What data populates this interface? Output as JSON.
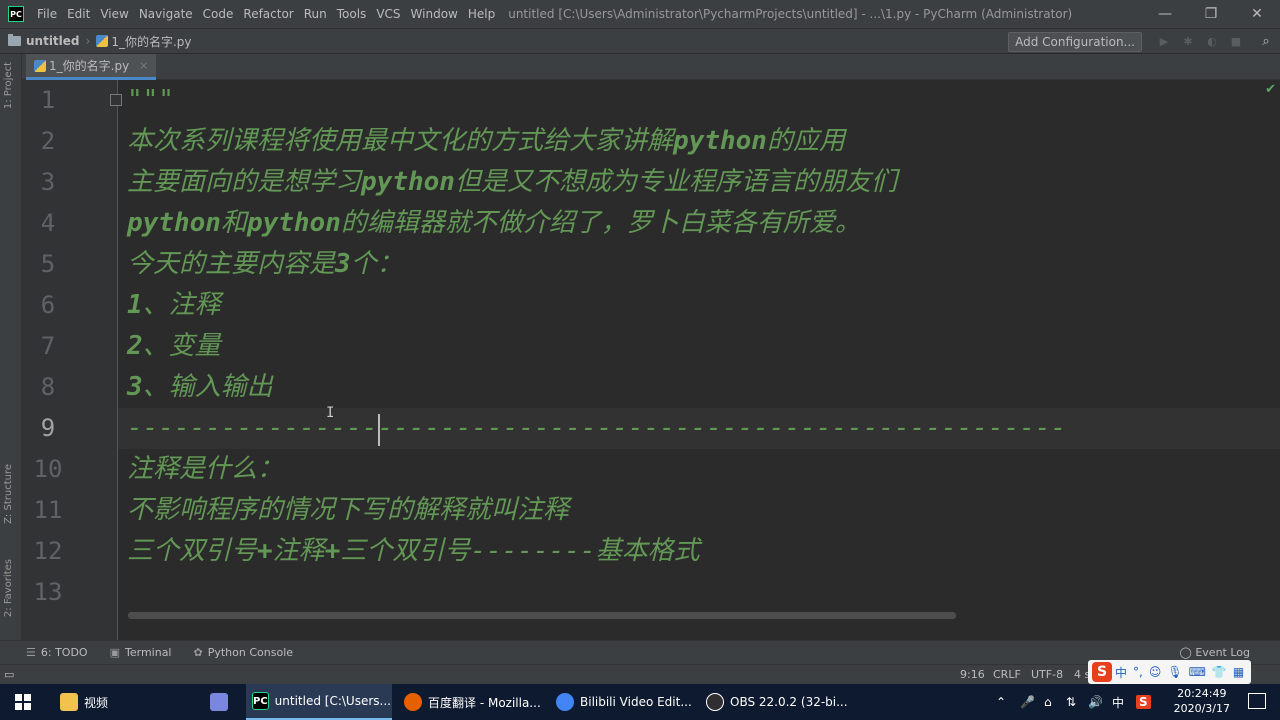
{
  "titlebar": {
    "logo": "PC",
    "menu": [
      "File",
      "Edit",
      "View",
      "Navigate",
      "Code",
      "Refactor",
      "Run",
      "Tools",
      "VCS",
      "Window",
      "Help"
    ],
    "window_title": "untitled [C:\\Users\\Administrator\\PycharmProjects\\untitled] - ...\\1.py - PyCharm (Administrator)",
    "controls": [
      "—",
      "❐",
      "✕"
    ]
  },
  "navbar": {
    "project": "untitled",
    "file": "1_你的名字.py",
    "add_configuration": "Add Configuration..."
  },
  "left_stripe": {
    "project": "1: Project",
    "structure": "Z: Structure",
    "favorites": "2: Favorites"
  },
  "editor_tab": {
    "label": "1_你的名字.py",
    "close": "×"
  },
  "editor": {
    "line_numbers": [
      "1",
      "2",
      "3",
      "4",
      "5",
      "6",
      "7",
      "8",
      "9",
      "10",
      "11",
      "12",
      "13"
    ],
    "lines": [
      "\"\"\"",
      "本次系列课程将使用最中文化的方式给大家讲解python的应用",
      "主要面向的是想学习python但是又不想成为专业程序语言的朋友们",
      "python和python的编辑器就不做介绍了，罗卜白菜各有所爱。",
      "今天的主要内容是3个：",
      "1、注释",
      "2、变量",
      "3、输入输出",
      "------------------------------------------------------------",
      "注释是什么：",
      "不影响程序的情况下写的解释就叫注释",
      "三个双引号+注释+三个双引号--------基本格式",
      ""
    ],
    "current_line": "9"
  },
  "bottom_tools": {
    "todo": "6: TODO",
    "terminal": "Terminal",
    "python_console": "Python Console",
    "event_log": "Event Log"
  },
  "statusbar": {
    "position": "9:16",
    "line_sep": "CRLF",
    "encoding": "UTF-8",
    "indent": "4 s"
  },
  "ime": {
    "logo": "S",
    "mode": "中"
  },
  "taskbar": {
    "items": [
      {
        "label": "视频",
        "icon_color": "#f2c14e"
      },
      {
        "label": "",
        "icon_color": "#7a86e0"
      },
      {
        "label": "untitled [C:\\Users...",
        "icon_color": "#21d789"
      },
      {
        "label": "百度翻译 - Mozilla...",
        "icon_color": "#e66000"
      },
      {
        "label": "Bilibili Video Edit...",
        "icon_color": "#4285f4"
      },
      {
        "label": "OBS 22.0.2 (32-bi...",
        "icon_color": "#302e31"
      }
    ],
    "tray_lang": "中",
    "time": "20:24:49",
    "date": "2020/3/17"
  }
}
